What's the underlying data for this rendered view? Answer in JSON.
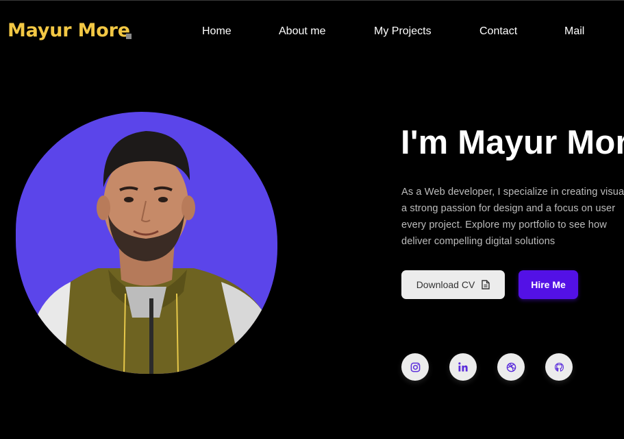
{
  "brand": {
    "name": "Mayur More",
    "accent": "#f2c744"
  },
  "nav": {
    "items": [
      {
        "label": "Home"
      },
      {
        "label": "About me"
      },
      {
        "label": "My Projects"
      },
      {
        "label": "Contact"
      },
      {
        "label": "Mail"
      }
    ]
  },
  "hero": {
    "headline": "I'm Mayur Mor",
    "bio_lines": [
      "As a Web developer, I specialize in creating visua",
      "a strong passion for design and a focus on user",
      "every project. Explore my portfolio to see how",
      "deliver compelling digital solutions"
    ],
    "download_cv_label": "Download CV",
    "hire_me_label": "Hire Me",
    "avatar_bg_color": "#5b45ea",
    "hire_color": "#5311e6"
  },
  "social": {
    "icons": [
      "instagram-icon",
      "linkedin-icon",
      "dribbble-icon",
      "github-icon"
    ],
    "icon_color": "#5b2ddb"
  }
}
